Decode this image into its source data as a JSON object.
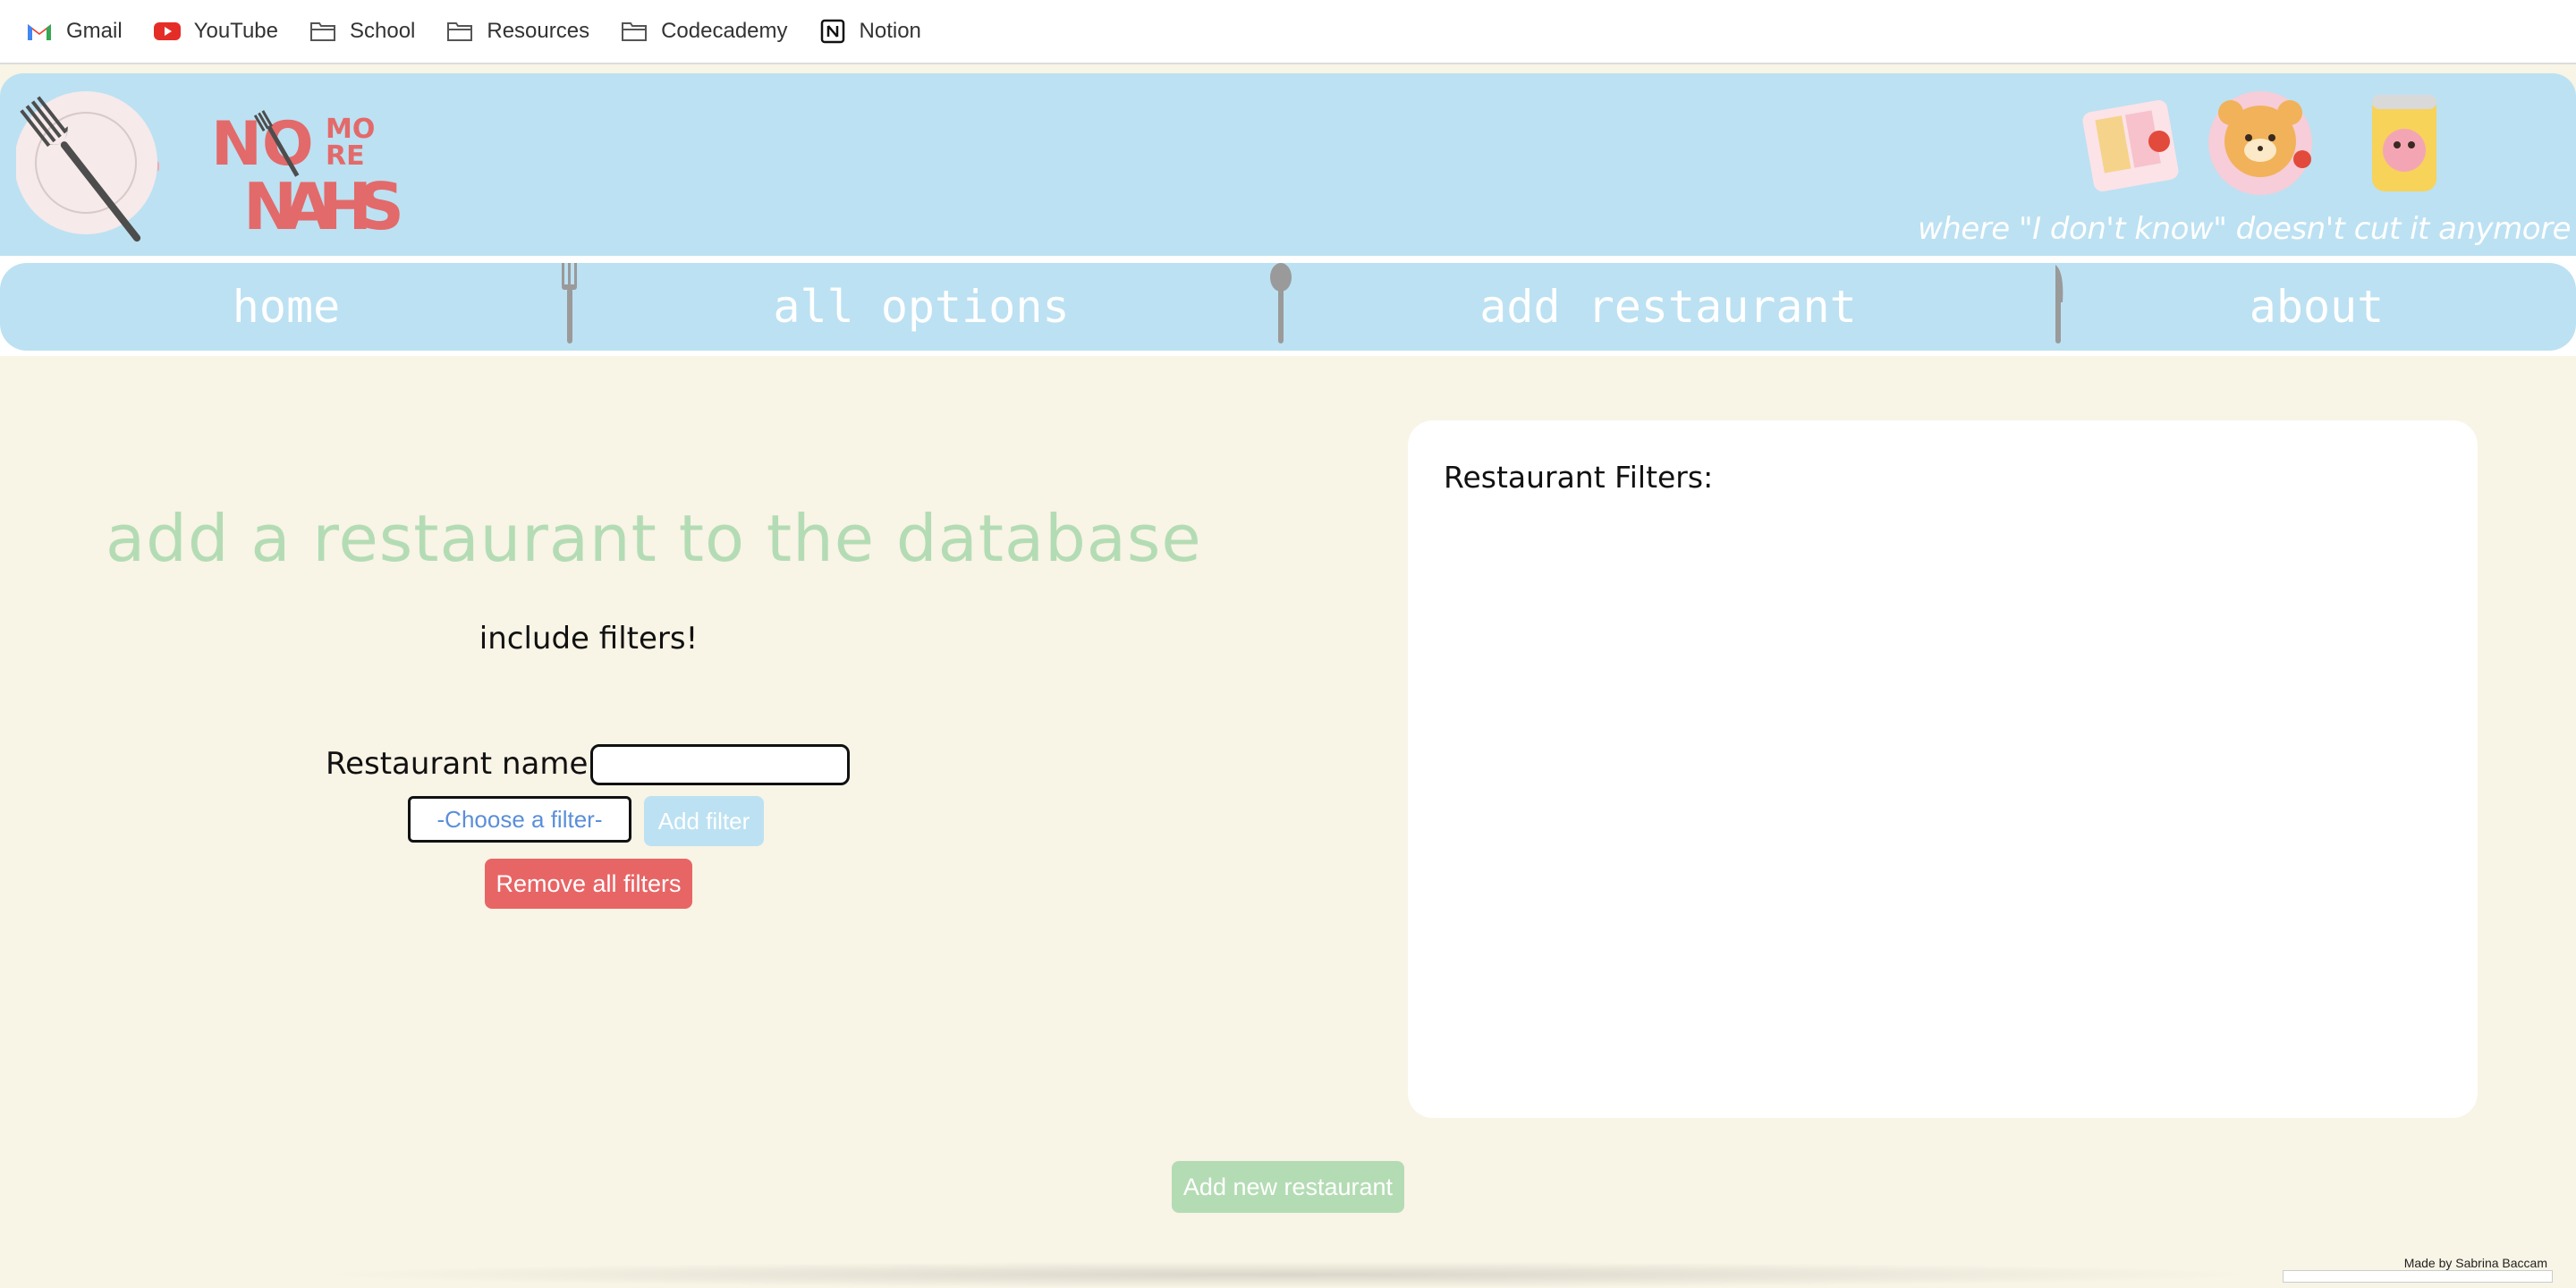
{
  "bookmarks": [
    {
      "label": "Gmail",
      "icon": "gmail-icon"
    },
    {
      "label": "YouTube",
      "icon": "youtube-icon"
    },
    {
      "label": "School",
      "icon": "folder-icon"
    },
    {
      "label": "Resources",
      "icon": "folder-icon"
    },
    {
      "label": "Codecademy",
      "icon": "folder-icon"
    },
    {
      "label": "Notion",
      "icon": "notion-icon"
    }
  ],
  "header": {
    "logo_text": [
      "NO",
      "MO",
      "RE",
      "NAHS"
    ],
    "tagline": "where \"I don't know\" doesn't cut it anymore"
  },
  "nav": {
    "items": [
      "home",
      "all options",
      "add restaurant",
      "about"
    ]
  },
  "main": {
    "title": "add a restaurant to the database",
    "subtitle": "include filters!",
    "name_label": "Restaurant name:",
    "name_value": "",
    "filter_select": "-Choose a filter-",
    "add_filter_label": "Add filter",
    "remove_filters_label": "Remove all filters",
    "add_restaurant_label": "Add new restaurant"
  },
  "panel": {
    "title": "Restaurant Filters:"
  },
  "footer": {
    "credit": "Made by Sabrina Baccam"
  },
  "colors": {
    "background": "#f8f4e6",
    "banner": "#bce1f2",
    "title_green": "#b4dcb4",
    "remove_red": "#e86566",
    "logo_red": "#e36a6a"
  }
}
